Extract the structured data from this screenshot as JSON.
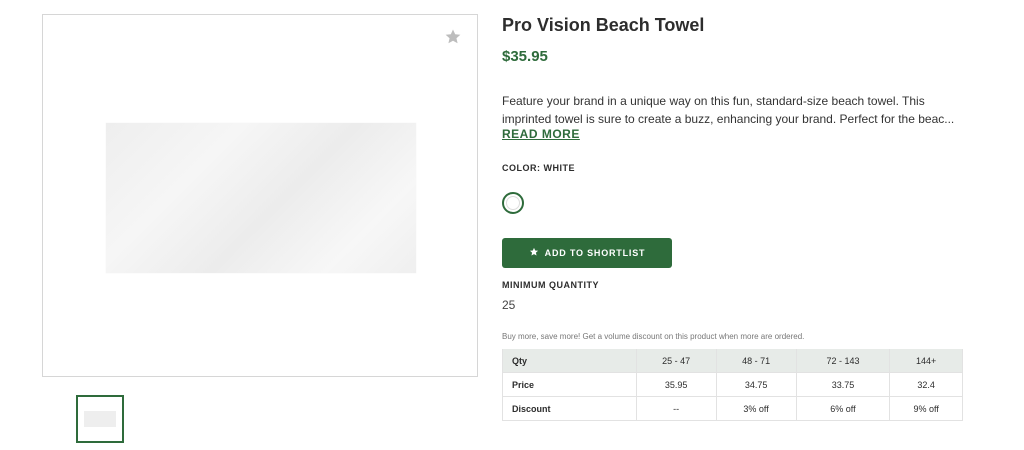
{
  "product": {
    "title": "Pro Vision Beach Towel",
    "price": "$35.95",
    "description_line1": "Feature your brand in a unique way on this fun, standard-size beach towel. This",
    "description_line2": "imprinted towel is sure to create a buzz, enhancing your brand. Perfect for the beac...",
    "read_more": "READ MORE",
    "color_label": "COLOR: WHITE",
    "swatch_color": "#ffffff",
    "shortlist_button": "ADD TO SHORTLIST",
    "min_qty_label": "MINIMUM QUANTITY",
    "min_qty_value": "25",
    "volume_note": "Buy more, save more! Get a volume discount on this product when more are ordered."
  },
  "pricing_table": {
    "headers": [
      "Qty",
      "25 - 47",
      "48 - 71",
      "72 - 143",
      "144+"
    ],
    "rows": [
      [
        "Price",
        "35.95",
        "34.75",
        "33.75",
        "32.4"
      ],
      [
        "Discount",
        "--",
        "3% off",
        "6% off",
        "9% off"
      ]
    ]
  },
  "icons": {
    "favorite": "star-icon",
    "shortlist": "star-icon"
  },
  "colors": {
    "accent": "#2e6b3b",
    "table_header_bg": "#e7ebe8"
  }
}
